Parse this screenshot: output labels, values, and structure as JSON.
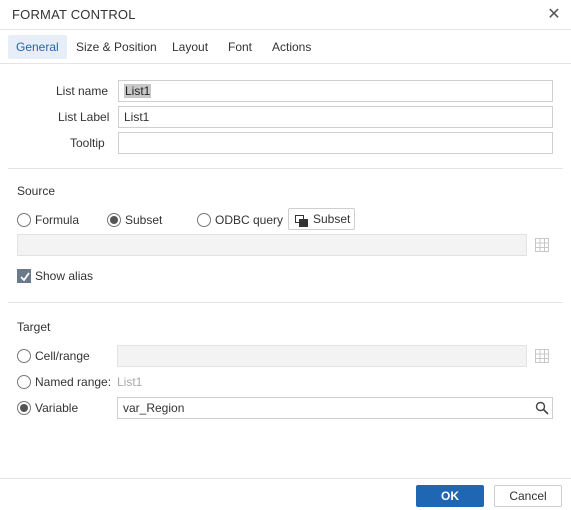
{
  "dialog": {
    "title": "FORMAT CONTROL",
    "close_icon": "close-icon"
  },
  "tabs": [
    {
      "label": "General",
      "active": true
    },
    {
      "label": "Size & Position",
      "active": false
    },
    {
      "label": "Layout",
      "active": false
    },
    {
      "label": "Font",
      "active": false
    },
    {
      "label": "Actions",
      "active": false
    }
  ],
  "general": {
    "list_name_label": "List name",
    "list_name_value": "List1",
    "list_label_label": "List Label",
    "list_label_value": "List1",
    "tooltip_label": "Tooltip",
    "tooltip_value": ""
  },
  "source": {
    "title": "Source",
    "options": [
      {
        "label": "Formula",
        "checked": false
      },
      {
        "label": "Subset",
        "checked": true
      },
      {
        "label": "ODBC query",
        "checked": false
      }
    ],
    "subset_button_label": "Subset",
    "source_field_value": "",
    "show_alias_label": "Show alias",
    "show_alias_checked": true
  },
  "target": {
    "title": "Target",
    "cell_range_label": "Cell/range",
    "cell_range_value": "",
    "named_range_label": "Named range:",
    "named_range_value": "List1",
    "variable_label": "Variable",
    "variable_value": "var_Region",
    "selected": "Variable"
  },
  "footer": {
    "ok_label": "OK",
    "cancel_label": "Cancel"
  },
  "colors": {
    "accent": "#1f66b3",
    "active_tab_bg": "#e7eef7",
    "border": "#cfcfcf",
    "divider": "#e4e4e4"
  }
}
